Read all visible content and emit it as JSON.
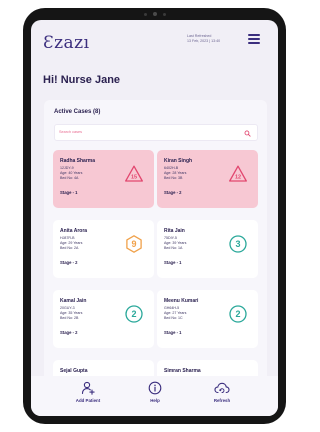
{
  "app": {
    "logo_text": "Ɛzazı",
    "last_refreshed_label": "Last Refreshed",
    "last_refreshed_value": "13 Feb, 2023 | 13:40",
    "greeting": "Hi! Nurse Jane"
  },
  "cases_panel": {
    "title": "Active Cases (8)",
    "search_placeholder": "Search cases"
  },
  "cases": [
    {
      "name": "Radha Sharma",
      "id": "12JDY-9",
      "age": "Age: 40 Years",
      "bed": "Bed No: 4A",
      "stage": "Stage - 1",
      "score": "15",
      "shape": "triangle",
      "status_color": "#e2476f",
      "critical": true
    },
    {
      "name": "Kiran Singh",
      "id": "6402H-B",
      "age": "Age: 28 Years",
      "bed": "Bed No: 3B",
      "stage": "Stage - 2",
      "score": "12",
      "shape": "triangle",
      "status_color": "#e2476f",
      "critical": true
    },
    {
      "name": "Anita Arora",
      "id": "HJ87R-B",
      "age": "Age: 29 Years",
      "bed": "Bed No: 2A",
      "stage": "Stage - 2",
      "score": "9",
      "shape": "hexagon",
      "status_color": "#f0a14a",
      "critical": false
    },
    {
      "name": "Rita Jain",
      "id": "75DIY-5",
      "age": "Age: 39 Years",
      "bed": "Bed No: 1A",
      "stage": "Stage - 1",
      "score": "3",
      "shape": "circle",
      "status_color": "#2aa89a",
      "critical": false
    },
    {
      "name": "Kamal Jain",
      "id": "20GUY-3",
      "age": "Age: 35 Years",
      "bed": "Bed No: 2B",
      "stage": "Stage - 2",
      "score": "2",
      "shape": "circle",
      "status_color": "#2aa89a",
      "critical": false
    },
    {
      "name": "Meenu Kumari",
      "id": "GH64H-5",
      "age": "Age: 27 Years",
      "bed": "Bed No: 1C",
      "stage": "Stage - 1",
      "score": "2",
      "shape": "circle",
      "status_color": "#2aa89a",
      "critical": false
    },
    {
      "name": "Sejal Gupta",
      "id": "",
      "age": "",
      "bed": "",
      "stage": "",
      "score": "",
      "shape": "",
      "status_color": "#2aa89a",
      "critical": false
    },
    {
      "name": "Simran Sharma",
      "id": "",
      "age": "",
      "bed": "",
      "stage": "",
      "score": "",
      "shape": "",
      "status_color": "#2aa89a",
      "critical": false
    }
  ],
  "bottom_nav": [
    {
      "label": "Add Patient",
      "icon": "add-user-icon"
    },
    {
      "label": "Help",
      "icon": "info-icon"
    },
    {
      "label": "Refresh",
      "icon": "cloud-refresh-icon"
    }
  ],
  "colors": {
    "brand": "#3b2e7e",
    "critical_bg": "#f7c8d3",
    "accent_pink": "#e2476f",
    "warning": "#f0a14a",
    "normal": "#2aa89a"
  }
}
